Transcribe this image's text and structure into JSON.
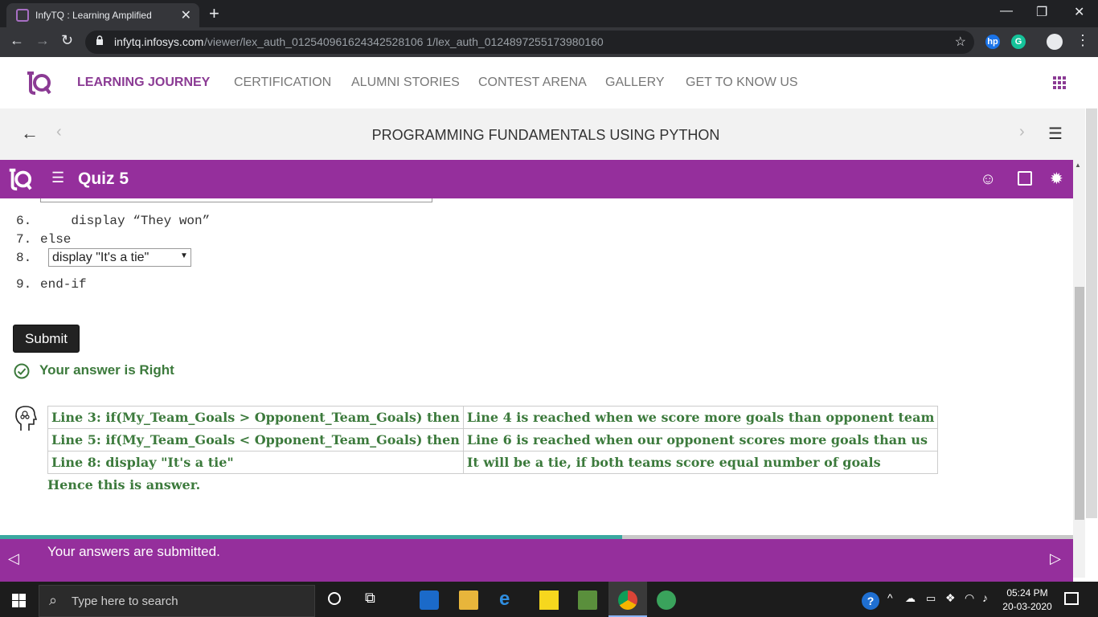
{
  "browser": {
    "tab_title": "InfyTQ : Learning Amplified",
    "url_host": "infytq.infosys.com",
    "url_path": "/viewer/lex_auth_012540961624342528106 1/lex_auth_0124897255173980160",
    "extensions": [
      "hp",
      "G"
    ]
  },
  "sitenav": {
    "links": [
      "LEARNING JOURNEY",
      "CERTIFICATION",
      "ALUMNI STORIES",
      "CONTEST ARENA",
      "GALLERY",
      "GET TO KNOW US"
    ],
    "accent": "#8b3b94"
  },
  "course": {
    "title": "PROGRAMMING FUNDAMENTALS USING PYTHON"
  },
  "quiz": {
    "title": "Quiz 5",
    "bar_color": "#952f9c",
    "code_lines": [
      {
        "num": "6.",
        "text": "    display “They won”"
      },
      {
        "num": "7.",
        "text": "else"
      },
      {
        "num": "8.",
        "text": ""
      },
      {
        "num": "9.",
        "text": "end-if"
      }
    ],
    "line8_selected": "display \"It's a tie\"",
    "submit_label": "Submit",
    "result_text": "Your answer is Right",
    "explanation": [
      [
        "Line 3: if(My_Team_Goals > Opponent_Team_Goals) then",
        "Line 4 is reached when we score more goals than opponent team"
      ],
      [
        "Line 5: if(My_Team_Goals < Opponent_Team_Goals) then",
        "Line 6 is reached when our opponent scores more goals than us"
      ],
      [
        "Line 8: display \"It's a tie\"",
        "It will be a tie, if both teams score equal number of goals"
      ]
    ],
    "conclusion": "Hence this is answer.",
    "progress": 0.58,
    "footer_message": "Your answers are submitted."
  },
  "taskbar": {
    "search_placeholder": "Type here to search",
    "time": "05:24 PM",
    "date": "20-03-2020"
  }
}
